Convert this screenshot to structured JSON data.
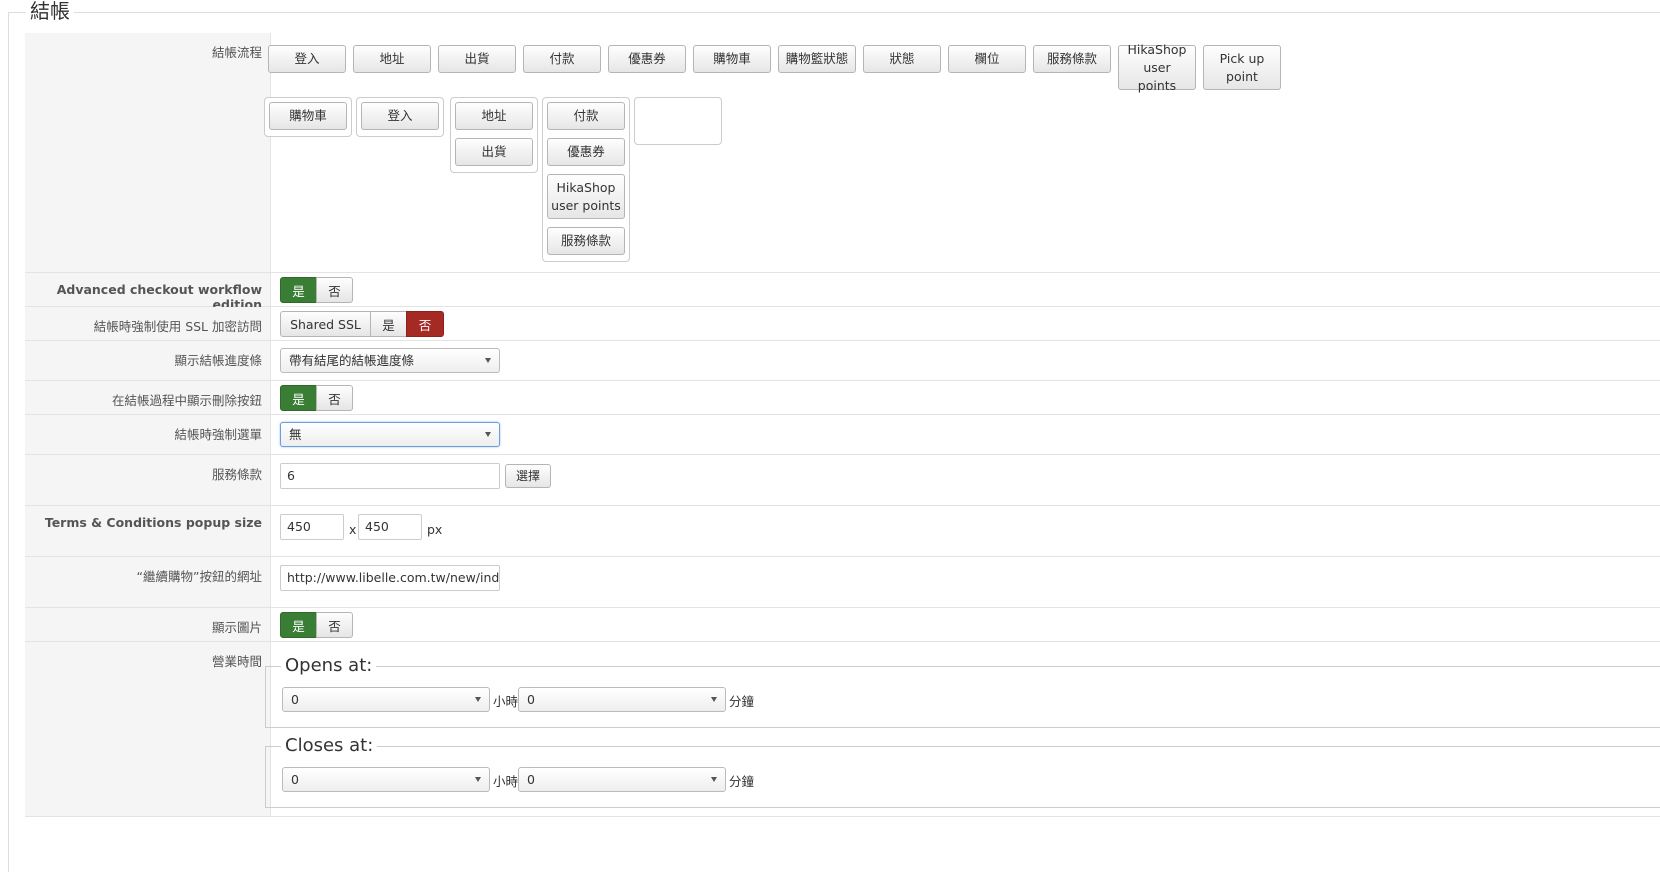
{
  "title": "結帳",
  "workflow": {
    "label": "結帳流程",
    "palette": [
      "登入",
      "地址",
      "出貨",
      "付款",
      "優惠券",
      "購物車",
      "購物籃狀態",
      "狀態",
      "欄位",
      "服務條款",
      "HikaShop user points",
      "Pick up point"
    ],
    "steps": [
      [
        "購物車"
      ],
      [
        "登入"
      ],
      [
        "地址",
        "出貨"
      ],
      [
        "付款",
        "優惠券",
        "HikaShop user points",
        "服務條款"
      ],
      []
    ]
  },
  "advanced": {
    "label": "Advanced checkout workflow edition",
    "yes": "是",
    "no": "否",
    "value": "yes"
  },
  "ssl": {
    "label": "結帳時強制使用 SSL 加密訪問",
    "shared": "Shared SSL",
    "yes": "是",
    "no": "否",
    "value": "no"
  },
  "progress": {
    "label": "顯示結帳進度條",
    "value": "帶有結尾的結帳進度條"
  },
  "delete_btn": {
    "label": "在結帳過程中顯示刪除按鈕",
    "yes": "是",
    "no": "否",
    "value": "yes"
  },
  "force_menu": {
    "label": "結帳時強制選單",
    "value": "無"
  },
  "terms": {
    "label": "服務條款",
    "value": "6",
    "select": "選擇"
  },
  "popup": {
    "label": "Terms & Conditions popup size",
    "width": "450",
    "height": "450",
    "x": "x",
    "unit": "px"
  },
  "continue_url": {
    "label": "“繼續購物”按鈕的網址",
    "value": "http://www.libelle.com.tw/new/index.php"
  },
  "show_image": {
    "label": "顯示圖片",
    "yes": "是",
    "no": "否",
    "value": "yes"
  },
  "hours": {
    "label": "營業時間",
    "opens": {
      "legend": "Opens at:",
      "hour": "0",
      "minute": "0"
    },
    "closes": {
      "legend": "Closes at:",
      "hour": "0",
      "minute": "0"
    },
    "hour_unit": "小時",
    "minute_unit": "分鐘"
  }
}
